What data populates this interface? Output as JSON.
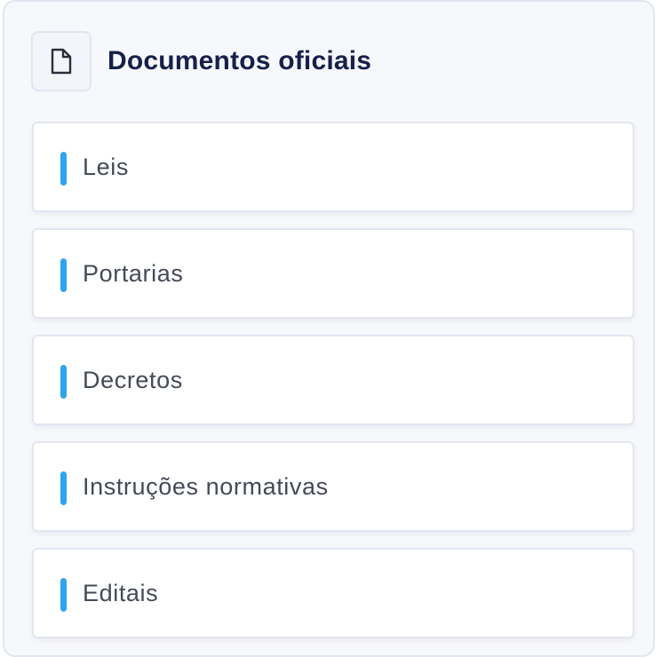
{
  "header": {
    "icon": "document-icon",
    "title": "Documentos oficiais"
  },
  "items": [
    {
      "label": "Leis"
    },
    {
      "label": "Portarias"
    },
    {
      "label": "Decretos"
    },
    {
      "label": "Instruções normativas"
    },
    {
      "label": "Editais"
    }
  ],
  "colors": {
    "accent": "#2ea4f0",
    "title": "#16204a",
    "label": "#444a57",
    "border": "#e3e6f1"
  }
}
